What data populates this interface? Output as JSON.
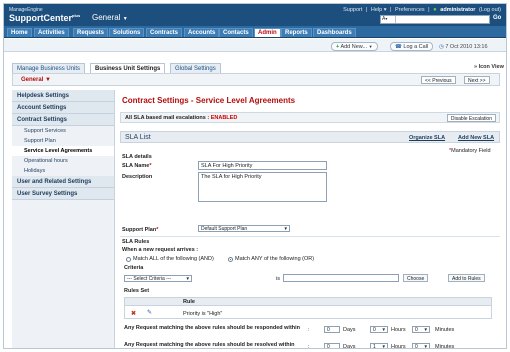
{
  "header": {
    "brand_small": "ManageEngine",
    "brand": "SupportCenter",
    "brand_sup": "plus",
    "product": "General",
    "product_caret": "▼",
    "links": [
      "Support",
      "|",
      "Help ▾",
      "|",
      "Preferences",
      "|"
    ],
    "user_dot": "●",
    "user": "administrator",
    "logout": "(Log out)",
    "search_select": "A",
    "go": "Go"
  },
  "nav": {
    "tabs": [
      "Home",
      "Activities",
      "Requests",
      "Solutions",
      "Contracts",
      "Accounts",
      "Contacts",
      "Admin",
      "Reports",
      "Dashboards"
    ],
    "active": "Admin"
  },
  "actions": {
    "add_new": "Add New...",
    "add_new_caret": "▼",
    "log_call": "Log a Call",
    "datetime": "7 Oct 2010 13:16"
  },
  "business_unit": {
    "tabs": [
      "Manage Business Units",
      "Business Unit Settings",
      "Global Settings"
    ],
    "active": "Business Unit Settings",
    "icon_view": "» Icon View",
    "unit": "General ▼",
    "previous": "<< Previous",
    "next": "Next >>"
  },
  "left_menu": {
    "helpdesk": "Helpdesk Settings",
    "account": "Account Settings",
    "contract": "Contract Settings",
    "contract_items": [
      "Support Services",
      "Support Plan",
      "Service Level Agreements",
      "Operational hours",
      "Holidays"
    ],
    "active_item": "Service Level Agreements",
    "user_related": "User and Related Settings",
    "user_survey": "User Survey Settings"
  },
  "content": {
    "title": "Contract Settings - Service Level Agreements",
    "escalation_label": "All SLA based mail escalations :",
    "escalation_state": "ENABLED",
    "disable_button": "Disable Escalation",
    "sla_list": "SLA List",
    "organize": "Organize SLA",
    "add_new": "Add New SLA",
    "details_heading": "SLA details",
    "mandatory_star": "*",
    "mandatory": "Mandatory Field",
    "sla_name_label": "SLA Name",
    "sla_name_value": "SLA For High Priority",
    "description_label": "Description",
    "description_value": "The SLA for High Priority",
    "support_plan_label": "Support Plan",
    "support_plan_value": "Default Support Plan",
    "rules_heading": "SLA Rules",
    "when_label": "When a new request arrives :",
    "match_all": "Match ALL of the following (AND)",
    "match_any": "Match ANY of the following (OR)",
    "criteria_label": "Criteria",
    "criteria_select": "--- Select Criteria ---",
    "is_label": "is",
    "choose": "Choose",
    "add_rules": "Add to Rules",
    "rules_set": "Rules Set",
    "rule_col": "Rule",
    "rule_text": "Priority is \"High\"",
    "respond_label": "Any Request matching the above rules should be responded within",
    "resolve_label": "Any Request matching the above rules should be resolved within",
    "colon": ":",
    "days": "Days",
    "hours": "Hours",
    "minutes": "Minutes",
    "respond_days": "0",
    "respond_hours": "0",
    "respond_minutes": "0",
    "resolve_days": "0",
    "resolve_hours": "1",
    "resolve_minutes": "0"
  }
}
